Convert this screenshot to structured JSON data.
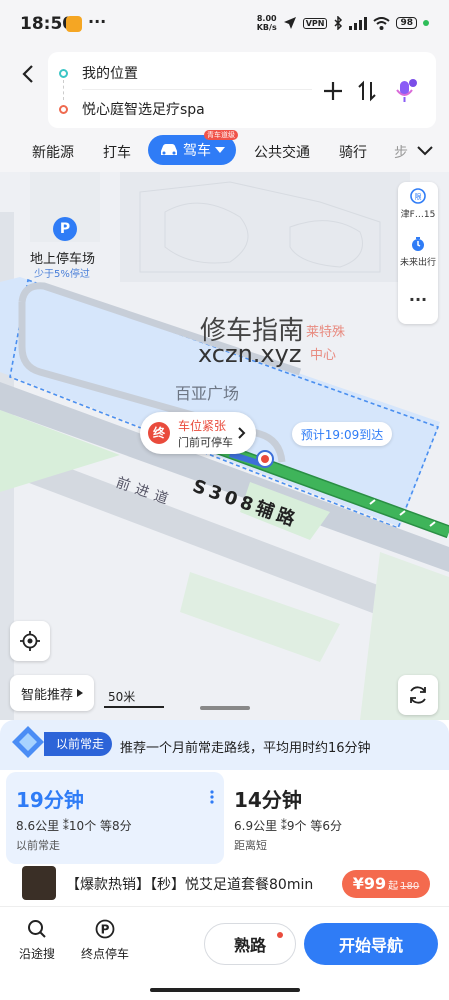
{
  "status_bar": {
    "time": "18:50",
    "more": "···",
    "net_speed_value": "8.00",
    "net_speed_unit": "KB/s",
    "vpn": "VPN",
    "battery": "98"
  },
  "route": {
    "origin": "我的位置",
    "destination": "悦心庭智选足疗spa"
  },
  "tabs": {
    "items": [
      "新能源",
      "打车",
      "驾车",
      "公共交通",
      "骑行",
      "步"
    ],
    "active_badge": "青车道级"
  },
  "map": {
    "parking_name": "地上停车场",
    "parking_sub": "少于5%停过",
    "watermark_cn": "修车指南",
    "watermark_url": "xczn.xyz",
    "poi_faded": "莱特殊",
    "poi_faded_2": "中心",
    "plaza": "百亚广场",
    "end_badge": "终",
    "parking_tight": "车位紧张",
    "parking_tip": "门前可停车",
    "eta": "预计19:09到达",
    "road_1": "S308辅路",
    "road_2": "前进道",
    "side_restrict": "津F…15",
    "side_future": "未来出行",
    "side_more": "···",
    "smart": "智能推荐",
    "scale": "50米",
    "colors": {
      "route_green": "#3fb45a",
      "route_dark": "#2a8f44",
      "accent_blue": "#2f7cf6",
      "end_red": "#e94b3c"
    }
  },
  "sheet": {
    "habit_tag": "以前常走",
    "habit_text": "推荐一个月前常走路线，平均用时约16分钟",
    "routes": [
      {
        "time": "19分钟",
        "distance": "8.6公里",
        "lights": "10个",
        "wait": "等8分",
        "tag": "以前常走"
      },
      {
        "time": "14分钟",
        "distance": "6.9公里",
        "lights": "9个",
        "wait": "等6分",
        "tag": "距离短"
      }
    ],
    "promo_text": "【爆款热销】【秒】悦艾足道套餐80min",
    "promo_price": "¥99",
    "promo_from": "起",
    "promo_orig": "180",
    "along_search": "沿途搜",
    "end_parking": "终点停车",
    "familiar": "熟路",
    "start_nav": "开始导航"
  }
}
